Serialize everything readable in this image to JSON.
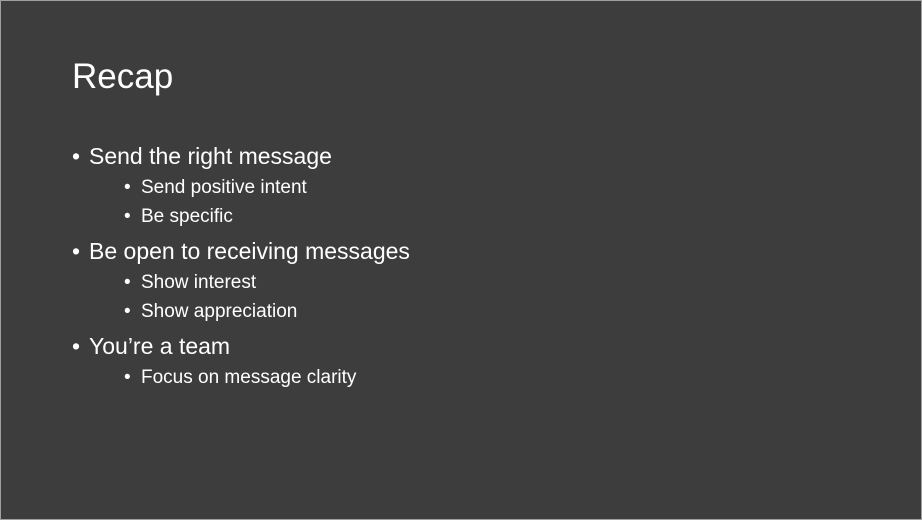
{
  "slide": {
    "title": "Recap",
    "bullets": [
      {
        "text": "Send the right message",
        "sub": [
          "Send positive intent",
          "Be specific"
        ]
      },
      {
        "text": "Be open to receiving messages",
        "sub": [
          "Show interest",
          "Show appreciation"
        ]
      },
      {
        "text": "You’re a team",
        "sub": [
          "Focus on message clarity"
        ]
      }
    ]
  },
  "colors": {
    "background": "#3d3d3d",
    "text": "#ffffff",
    "border": "#a0a0a0"
  }
}
